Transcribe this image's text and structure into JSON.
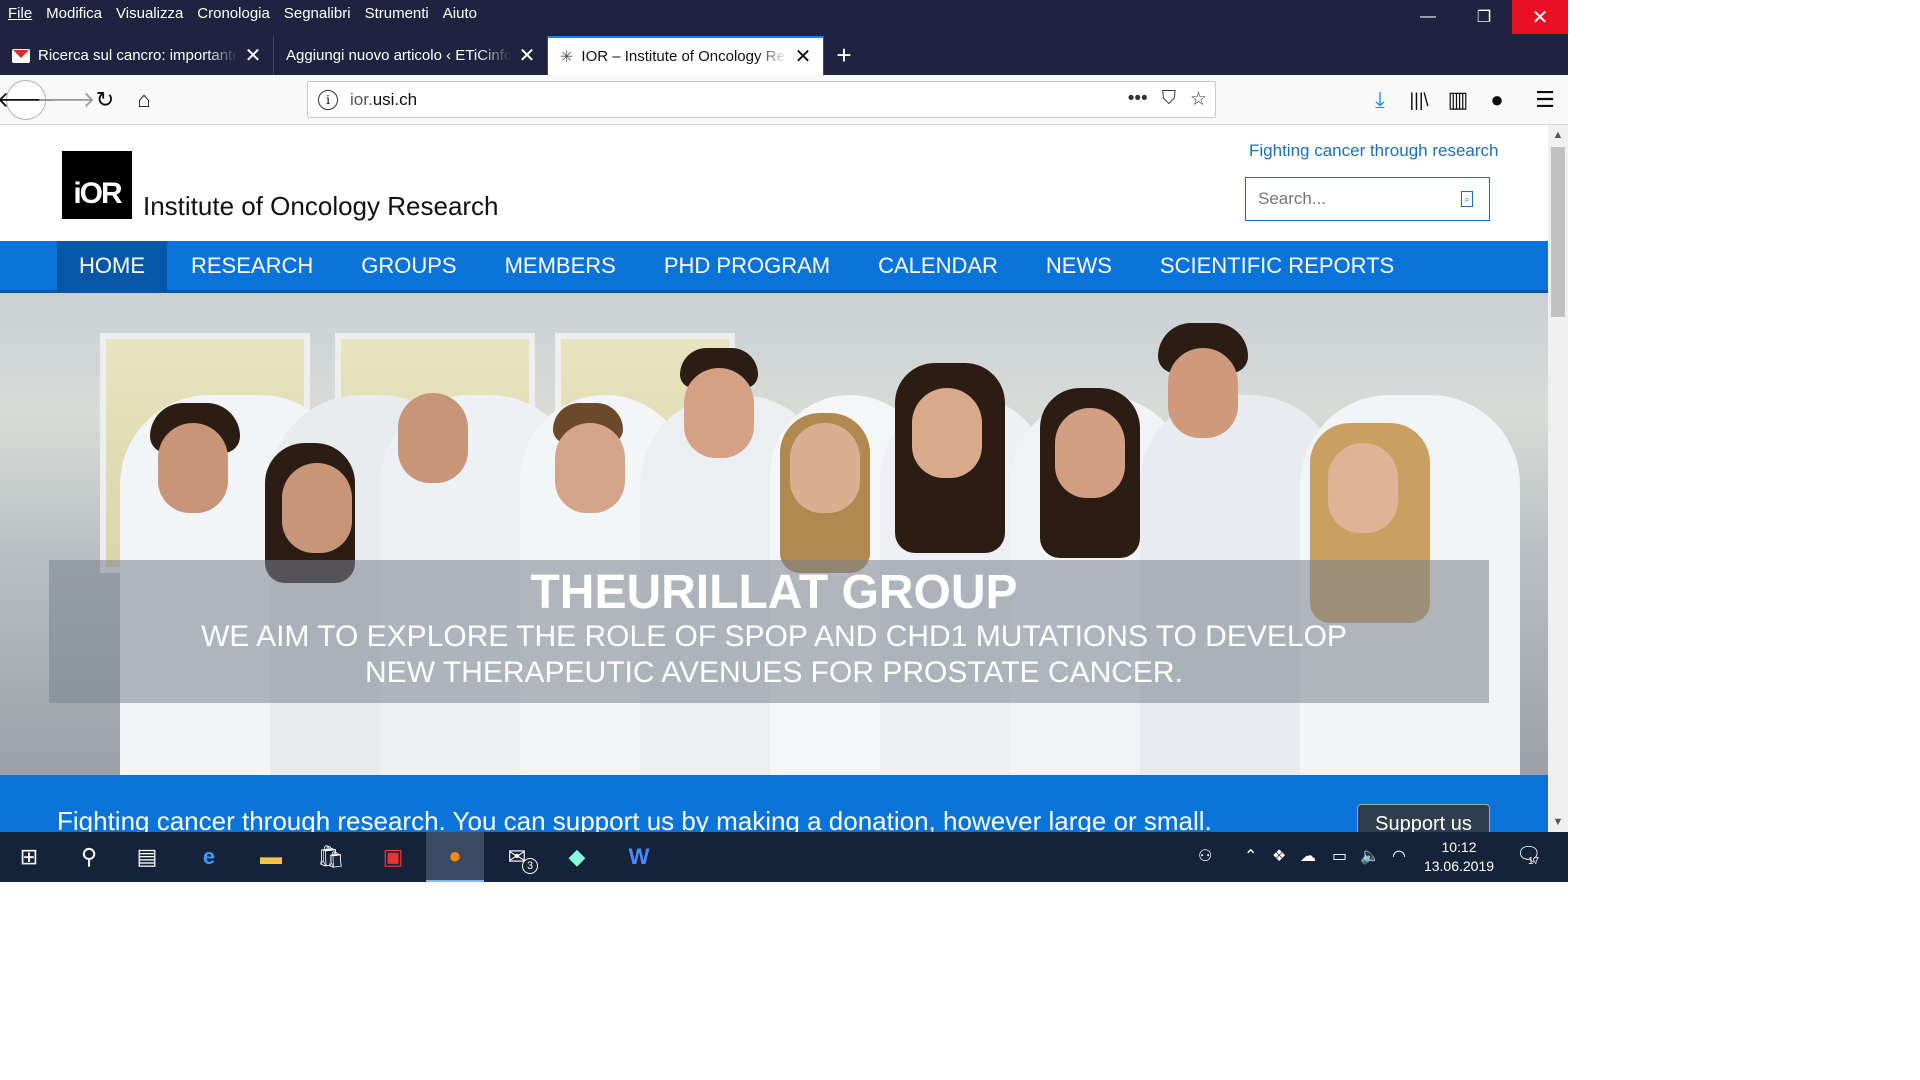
{
  "menu": [
    "File",
    "Modifica",
    "Visualizza",
    "Cronologia",
    "Segnalibri",
    "Strumenti",
    "Aiuto"
  ],
  "window_controls": {
    "minimize": "—",
    "maximize": "❐",
    "close": "✕"
  },
  "tabs": [
    {
      "title": "Ricerca sul cancro: importante i",
      "icon": "gmail-icon",
      "active": false
    },
    {
      "title": "Aggiungi nuovo articolo ‹ ETiCinfor",
      "icon": "none",
      "active": false
    },
    {
      "title": "IOR – Institute of Oncology Res",
      "icon": "ior-favicon",
      "active": true
    }
  ],
  "new_tab": "+",
  "url": {
    "host_prefix": "ior.",
    "host_domain": "usi.ch"
  },
  "page": {
    "logo_mark": "iOR",
    "logo_text": "Institute of Oncology Research",
    "tagline": "Fighting cancer through research",
    "search_placeholder": "Search...",
    "nav": [
      "HOME",
      "RESEARCH",
      "GROUPS",
      "MEMBERS",
      "PHD PROGRAM",
      "CALENDAR",
      "NEWS",
      "SCIENTIFIC REPORTS"
    ],
    "hero_title": "THEURILLAT GROUP",
    "hero_subtitle": "WE AIM TO EXPLORE THE ROLE OF SPOP AND CHD1 MUTATIONS TO DEVELOP NEW THERAPEUTIC AVENUES FOR PROSTATE CANCER.",
    "donate_text": "Fighting cancer through research. You can support us by making a donation, however large or small.",
    "support_button": "Support us"
  },
  "taskbar": {
    "mail_badge": "3",
    "time": "10:12",
    "date": "13.06.2019",
    "notifications": "17"
  },
  "colors": {
    "brand_blue": "#0a73d9",
    "nav_active": "#0757a9",
    "titlebar": "#202340",
    "taskbar": "#15233a"
  }
}
